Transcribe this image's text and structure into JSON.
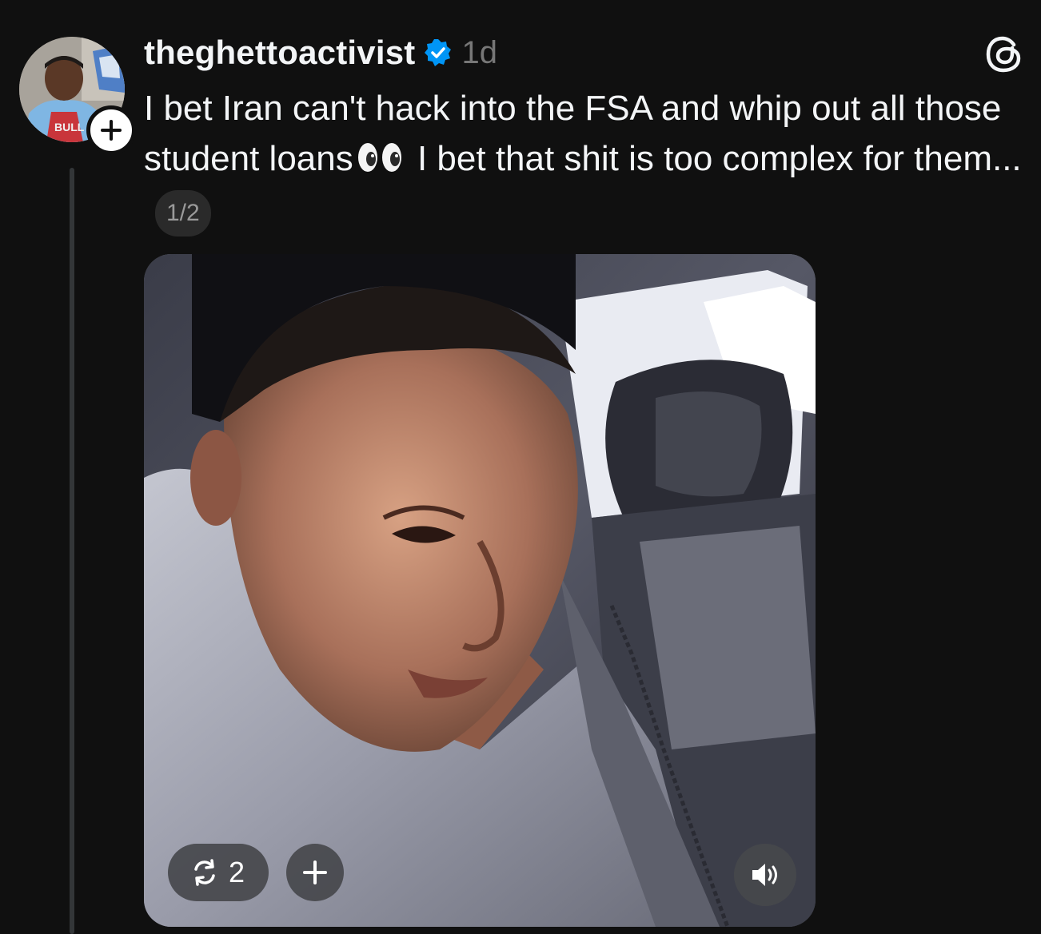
{
  "post": {
    "username": "theghettoactivist",
    "verified": true,
    "time": "1d",
    "text_before_emoji": "I bet Iran can't hack into the FSA and whip out all those student loans",
    "emoji": "👀",
    "text_after_emoji": " I bet that shit is too complex for them...",
    "page_indicator": "1/2",
    "repost_count": "2"
  },
  "icons": {
    "verified": "verified-badge-icon",
    "follow": "plus-icon",
    "app_logo": "threads-logo-icon",
    "repost": "repost-icon",
    "add": "plus-icon",
    "sound": "speaker-icon"
  },
  "colors": {
    "background": "#101010",
    "text_primary": "#f3f5f7",
    "text_secondary": "#777777",
    "verified_blue": "#0095f6",
    "thread_line": "#333638"
  }
}
